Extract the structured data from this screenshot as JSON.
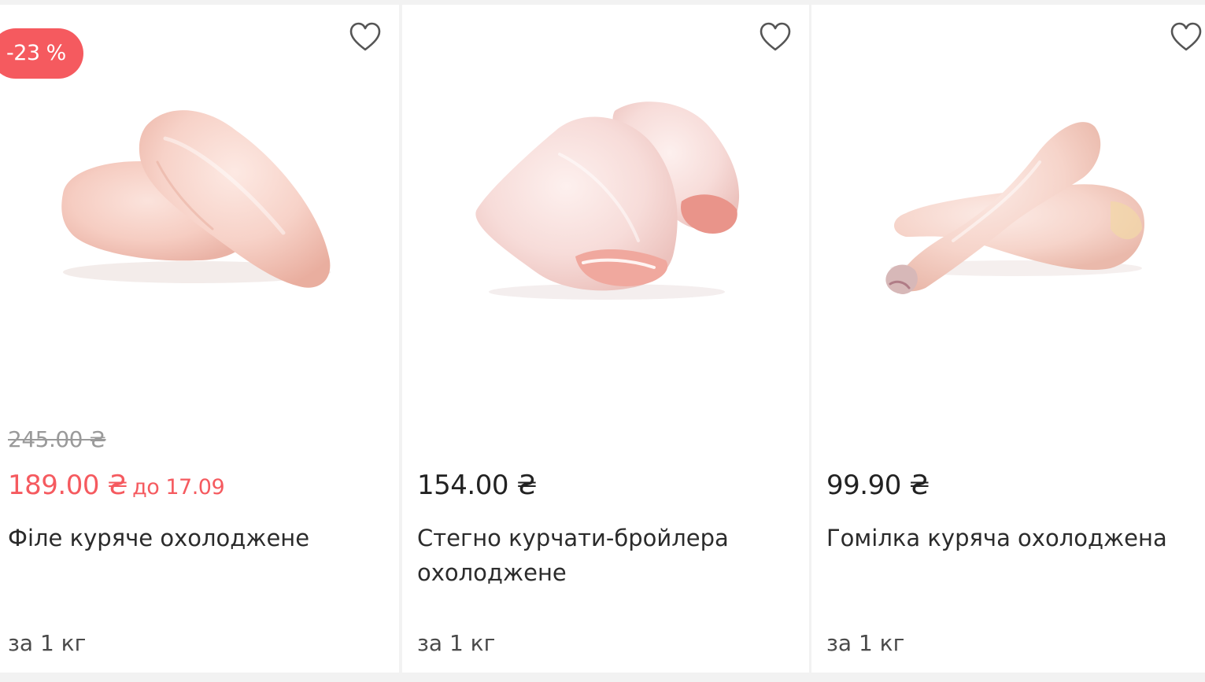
{
  "colors": {
    "accent": "#f55a5f",
    "text": "#2b2b2b",
    "muted": "#9a9a9a",
    "background": "#f2f2f2"
  },
  "products": [
    {
      "badge": "-23 %",
      "old_price": "245.00 ₴",
      "price": "189.00 ₴",
      "promo_until": "до 17.09",
      "name": "Філе куряче охолоджене",
      "unit": "за 1 кг",
      "image_icon": "chicken-fillet-image",
      "favorite_icon": "heart-outline-icon"
    },
    {
      "price": "154.00 ₴",
      "name": "Стегно курчати-бройлера охолоджене",
      "unit": "за 1 кг",
      "image_icon": "chicken-thigh-image",
      "favorite_icon": "heart-outline-icon"
    },
    {
      "price": "99.90 ₴",
      "name": "Гомілка куряча охолоджена",
      "unit": "за 1 кг",
      "image_icon": "chicken-drumstick-image",
      "favorite_icon": "heart-outline-icon"
    }
  ]
}
